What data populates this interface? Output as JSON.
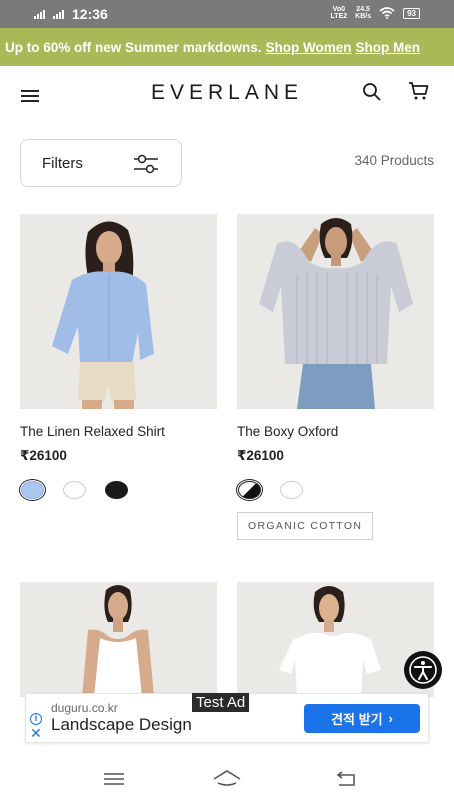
{
  "status_bar": {
    "time": "12:36",
    "network_top": "Vo0",
    "network_bottom": "LTE2",
    "speed_value": "24.5",
    "speed_unit": "KB/s",
    "battery": "93"
  },
  "promo": {
    "text": "Up to 60% off new Summer markdowns.",
    "link_women": "Shop Women",
    "link_men": "Shop Men"
  },
  "header": {
    "logo": "EVERLANE"
  },
  "filters": {
    "label": "Filters",
    "product_count": "340 Products"
  },
  "products": [
    {
      "name": "The Linen Relaxed Shirt",
      "price": "₹26100",
      "swatches": [
        "#a9c7ef",
        "#ffffff",
        "#1b1b1b"
      ],
      "badge": ""
    },
    {
      "name": "The Boxy Oxford",
      "price": "₹26100",
      "swatches": [
        "stripe",
        "#ffffff"
      ],
      "badge": "ORGANIC COTTON"
    }
  ],
  "ad": {
    "tag": "Test Ad",
    "domain": "duguru.co.kr",
    "title": "Landscape Design",
    "cta": "견적 받기"
  },
  "colors": {
    "promo_bg": "#a9b957",
    "ad_cta": "#1a73e8"
  }
}
